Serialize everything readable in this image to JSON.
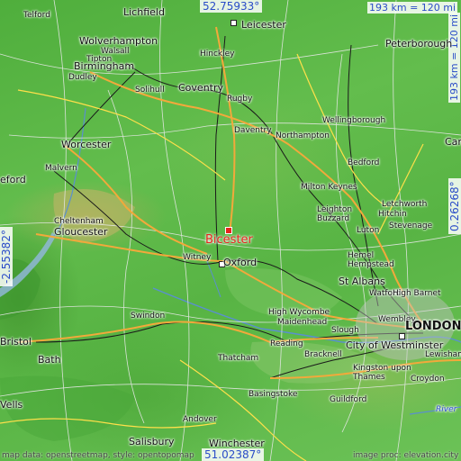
{
  "map": {
    "highlight": {
      "name": "Bicester",
      "color": "#e8231c"
    },
    "coordinates": {
      "top": "52.75933°",
      "bottom": "51.02387°",
      "left": "-2.55382°",
      "right": "0.26268°"
    },
    "scale": {
      "top": "193 km = 120 mi",
      "right": "193 km = 120 mi"
    },
    "attribution": {
      "left": "map data: openstreetmap, style: opentopomap",
      "right": "image proc: elevation.city"
    },
    "cities": {
      "telford": "Telford",
      "lichfield": "Lichfield",
      "leicester": "Leicester",
      "wolverhampton": "Wolverhampton",
      "walsall": "Walsall",
      "aldridge": "Aldridge",
      "tipton": "Tipton",
      "birmingham": "Birmingham",
      "dudley": "Dudley",
      "hinckley": "Hinckley",
      "peterborough": "Peterborough",
      "solihull": "Solihull",
      "coventry": "Coventry",
      "rugby": "Rugby",
      "wellingborough": "Wellingborough",
      "daventry": "Daventry",
      "northampton": "Northampton",
      "cambridge": "Cam",
      "worcester": "Worcester",
      "malvern": "Malvern",
      "bedford": "Bedford",
      "hereford": "eford",
      "milton_keynes": "Milton Keynes",
      "letchworth": "Letchworth",
      "hitchin": "Hitchin",
      "leighton_buzzard": "Leighton\nBuzzard",
      "stevenage": "Stevenage",
      "cheltenham": "Cheltenham",
      "gloucester": "Gloucester",
      "luton": "Luton",
      "bicester": "Bicester",
      "witney": "Witney",
      "oxford": "Oxford",
      "hemel": "Hemel\nHempstead",
      "st_albans": "St Albans",
      "watford": "Watford",
      "high_barnet": "High Barnet",
      "high_wycombe": "High Wycombe",
      "maidenhead": "Maidenhead",
      "wembley": "Wembley",
      "london": "LONDON",
      "swindon": "Swindon",
      "slough": "Slough",
      "city_westminster": "City of Westminster",
      "reading": "Reading",
      "bracknell": "Bracknell",
      "lewisham": "Lewisham",
      "bristol": "Bristol",
      "thatcham": "Thatcham",
      "kingston": "Kingston upon\nThames",
      "croydon": "Croydon",
      "bath": "Bath",
      "basingstoke": "Basingstoke",
      "guildford": "Guildford",
      "wells": "Vells",
      "andover": "Andover",
      "river": "River",
      "salisbury": "Salisbury",
      "winchester": "Winchester"
    }
  }
}
